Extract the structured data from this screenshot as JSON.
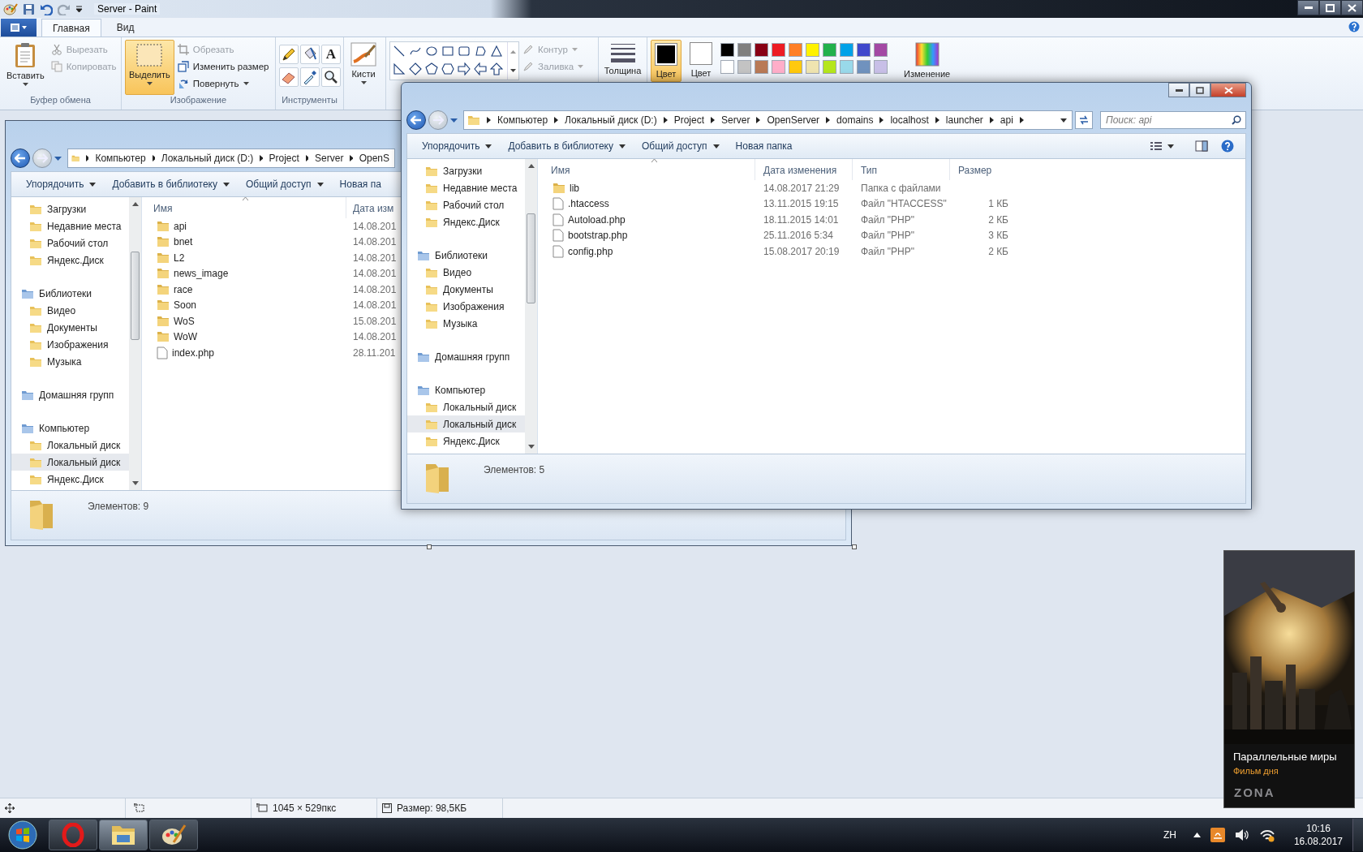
{
  "paint": {
    "title": "Server - Paint",
    "tabs": [
      {
        "label": "Главная",
        "selected": true
      },
      {
        "label": "Вид",
        "selected": false
      }
    ],
    "ribbon": {
      "clipboard": {
        "label": "Буфер обмена",
        "paste": "Вставить",
        "actions": [
          {
            "label": "Вырезать",
            "disabled": true
          },
          {
            "label": "Копировать",
            "disabled": true
          }
        ]
      },
      "image": {
        "label": "Изображение",
        "select": {
          "label": "Выделить",
          "selected": true
        },
        "actions": [
          {
            "label": "Обрезать",
            "disabled": true
          },
          {
            "label": "Изменить размер",
            "disabled": false
          },
          {
            "label": "Повернуть",
            "disabled": false
          }
        ]
      },
      "tools": {
        "label": "Инструменты",
        "text_tool": "A"
      },
      "brushes": "Кисти",
      "shape_options": [
        {
          "label": "Контур",
          "disabled": true
        },
        {
          "label": "Заливка",
          "disabled": true
        }
      ],
      "size": "Толщина",
      "colors": [
        {
          "label": "Цвет",
          "color": "#000000",
          "selected": true
        },
        {
          "label": "Цвет",
          "color": "#ffffff",
          "selected": false
        }
      ],
      "palette": [
        {
          "color": "#000000"
        },
        {
          "color": "#7f7f7f"
        },
        {
          "color": "#880015"
        },
        {
          "color": "#ed1c24"
        },
        {
          "color": "#ff7f27"
        },
        {
          "color": "#fff200"
        },
        {
          "color": "#22b14c"
        },
        {
          "color": "#00a2e8"
        },
        {
          "color": "#3f48cc"
        },
        {
          "color": "#a349a4"
        },
        {
          "color": "#ffffff"
        },
        {
          "color": "#c3c3c3"
        },
        {
          "color": "#b97a57"
        },
        {
          "color": "#ffaec9"
        },
        {
          "color": "#ffc90e"
        },
        {
          "color": "#efe4b0"
        },
        {
          "color": "#b5e61d"
        },
        {
          "color": "#99d9ea"
        },
        {
          "color": "#7092be"
        },
        {
          "color": "#c8bfe7"
        }
      ],
      "edit_colors": "Изменение"
    },
    "status_bar": {
      "dimensions": "1045 × 529пкс",
      "file_size": "Размер: 98,5КБ"
    }
  },
  "explorers": [
    {
      "window_controls": false,
      "breadcrumbs": [
        "Компьютер",
        "Локальный диск (D:)",
        "Project",
        "Server",
        "OpenS"
      ],
      "toolbar": [
        {
          "label": "Упорядочить",
          "menu": true
        },
        {
          "label": "Добавить в библиотеку",
          "menu": true
        },
        {
          "label": "Общий доступ",
          "menu": true
        },
        {
          "label": "Новая па",
          "menu": false
        }
      ],
      "nav": [
        {
          "children": [
            {
              "label": "Загрузки",
              "selected": false
            },
            {
              "label": "Недавние места",
              "selected": false
            },
            {
              "label": "Рабочий стол",
              "selected": false
            },
            {
              "label": "Яндекс.Диск",
              "selected": false
            }
          ]
        },
        {
          "label": "Библиотеки",
          "children": [
            {
              "label": "Видео",
              "selected": false
            },
            {
              "label": "Документы",
              "selected": false
            },
            {
              "label": "Изображения",
              "selected": false
            },
            {
              "label": "Музыка",
              "selected": false
            }
          ]
        },
        {
          "label": "Домашняя групп"
        },
        {
          "label": "Компьютер",
          "children": [
            {
              "label": "Локальный диск",
              "selected": false
            },
            {
              "label": "Локальный диск",
              "selected": true
            },
            {
              "label": "Яндекс.Диск",
              "selected": false
            }
          ]
        }
      ],
      "columns": [
        "Имя",
        "Дата изм"
      ],
      "files": [
        {
          "kind": "folder",
          "name": "api",
          "cells": [
            "14.08.201"
          ]
        },
        {
          "kind": "folder",
          "name": "bnet",
          "cells": [
            "14.08.201"
          ]
        },
        {
          "kind": "folder",
          "name": "L2",
          "cells": [
            "14.08.201"
          ]
        },
        {
          "kind": "folder",
          "name": "news_image",
          "cells": [
            "14.08.201"
          ]
        },
        {
          "kind": "folder",
          "name": "race",
          "cells": [
            "14.08.201"
          ]
        },
        {
          "kind": "folder",
          "name": "Soon",
          "cells": [
            "14.08.201"
          ]
        },
        {
          "kind": "folder",
          "name": "WoS",
          "cells": [
            "15.08.201"
          ]
        },
        {
          "kind": "folder",
          "name": "WoW",
          "cells": [
            "14.08.201"
          ]
        },
        {
          "kind": "file",
          "name": "index.php",
          "cells": [
            "28.11.201"
          ]
        }
      ],
      "status": "Элементов: 9"
    },
    {
      "window_controls": true,
      "breadcrumbs": [
        "Компьютер",
        "Локальный диск (D:)",
        "Project",
        "Server",
        "OpenServer",
        "domains",
        "localhost",
        "launcher",
        "api"
      ],
      "search": {
        "placeholder": "Поиск: api"
      },
      "toolbar": [
        {
          "label": "Упорядочить",
          "menu": true
        },
        {
          "label": "Добавить в библиотеку",
          "menu": true
        },
        {
          "label": "Общий доступ",
          "menu": true
        },
        {
          "label": "Новая папка",
          "menu": false
        }
      ],
      "nav": [
        {
          "children": [
            {
              "label": "Загрузки",
              "selected": false
            },
            {
              "label": "Недавние места",
              "selected": false
            },
            {
              "label": "Рабочий стол",
              "selected": false
            },
            {
              "label": "Яндекс.Диск",
              "selected": false
            }
          ]
        },
        {
          "label": "Библиотеки",
          "children": [
            {
              "label": "Видео",
              "selected": false
            },
            {
              "label": "Документы",
              "selected": false
            },
            {
              "label": "Изображения",
              "selected": false
            },
            {
              "label": "Музыка",
              "selected": false
            }
          ]
        },
        {
          "label": "Домашняя групп"
        },
        {
          "label": "Компьютер",
          "children": [
            {
              "label": "Локальный диск",
              "selected": false
            },
            {
              "label": "Локальный диск",
              "selected": true
            },
            {
              "label": "Яндекс.Диск",
              "selected": false
            }
          ]
        }
      ],
      "columns": [
        "Имя",
        "Дата изменения",
        "Тип",
        "Размер"
      ],
      "files": [
        {
          "kind": "folder",
          "name": "lib",
          "cells": [
            "14.08.2017 21:29",
            "Папка с файлами",
            ""
          ]
        },
        {
          "kind": "file",
          "name": ".htaccess",
          "cells": [
            "13.11.2015 19:15",
            "Файл \"HTACCESS\"",
            "1 КБ"
          ]
        },
        {
          "kind": "file",
          "name": "Autoload.php",
          "cells": [
            "18.11.2015 14:01",
            "Файл \"PHP\"",
            "2 КБ"
          ]
        },
        {
          "kind": "file",
          "name": "bootstrap.php",
          "cells": [
            "25.11.2016 5:34",
            "Файл \"PHP\"",
            "3 КБ"
          ]
        },
        {
          "kind": "file",
          "name": "config.php",
          "cells": [
            "15.08.2017 20:19",
            "Файл \"PHP\"",
            "2 КБ"
          ]
        }
      ],
      "status": "Элементов: 5"
    }
  ],
  "ad": {
    "title": "Параллельные миры",
    "subtitle": "Фильм дня",
    "brand": "ZONA"
  },
  "taskbar": {
    "language": "ZH",
    "time": "10:16",
    "date": "16.08.2017"
  }
}
